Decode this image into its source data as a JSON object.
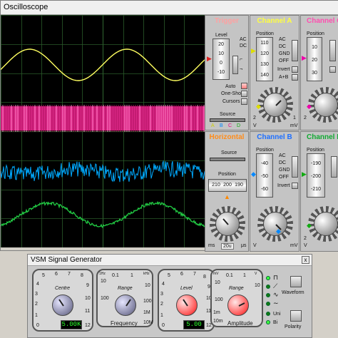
{
  "oscilloscope": {
    "title": "Oscilloscope",
    "colors": {
      "ch_a": "#ffff60",
      "ch_b": "#00aaff",
      "ch_c": "#ff2d9c",
      "ch_d": "#22cc44",
      "grid": "#2a5a2a"
    },
    "trigger": {
      "title": "Trigger",
      "level_label": "Level",
      "level_drum": [
        "20",
        "10",
        "0",
        "-10"
      ],
      "ac_label": "AC",
      "dc_label": "DC",
      "auto_label": "Auto",
      "oneshot_label": "One-Shot",
      "cursors_label": "Cursors",
      "source_label": "Source",
      "source_options": [
        "A",
        "B",
        "C",
        "D"
      ]
    },
    "channel_a": {
      "title": "Channel A",
      "position_label": "Position",
      "drum": [
        "110",
        "120",
        "130",
        "140"
      ],
      "modes": [
        "AC",
        "DC",
        "GND",
        "OFF"
      ],
      "invert_label": "Invert",
      "sum_label": "A+B",
      "knob_left": "2",
      "knob_right": "1",
      "unit_left": "V",
      "unit_right": "mV"
    },
    "channel_c": {
      "title": "Channel C",
      "position_label": "Position",
      "drum": [
        "10",
        "20",
        "30"
      ],
      "knob_left": "2"
    },
    "horizontal": {
      "title": "Horizontal",
      "source_label": "Source",
      "position_label": "Position",
      "drum": [
        "210",
        "200",
        "190"
      ],
      "knob_value": "20u",
      "unit_left": "ms",
      "unit_right": "μs"
    },
    "channel_b": {
      "title": "Channel B",
      "position_label": "Position",
      "drum": [
        "-40",
        "-50",
        "-60"
      ],
      "modes": [
        "AC",
        "DC",
        "GND",
        "OFF"
      ],
      "invert_label": "Invert",
      "unit_left": "V",
      "unit_right": "mV"
    },
    "channel_d": {
      "title": "Channel D",
      "position_label": "Position",
      "drum": [
        "-190",
        "-200",
        "-210"
      ],
      "knob_left": "2",
      "unit_left": "V"
    }
  },
  "generator": {
    "title": "VSM Signal Generator",
    "close_label": "x",
    "frequency": {
      "centre_label": "Centre",
      "centre_scale": [
        "4",
        "5",
        "6",
        "7",
        "8",
        "9",
        "10",
        "11",
        "12",
        "0",
        "1",
        "2",
        "3"
      ],
      "centre_lcd": "5.00K",
      "range_label": "Range",
      "range_scale": [
        "1Hz",
        "10",
        "100",
        "kHz",
        "0.1",
        "1",
        "10",
        "100",
        "1M",
        "10M"
      ],
      "section_label": "Frequency"
    },
    "amplitude": {
      "level_label": "Level",
      "level_scale": [
        "4",
        "5",
        "6",
        "7",
        "8",
        "9",
        "10",
        "11",
        "12",
        "0",
        "1",
        "2",
        "3"
      ],
      "level_lcd": "5.00",
      "range_label": "Range",
      "range_scale": [
        "mV",
        "10",
        "100",
        "V",
        "0.1",
        "1",
        "10",
        "1m",
        "10m"
      ],
      "section_label": "Amplitude"
    },
    "waveform_label": "Waveform",
    "polarity_label": "Polarity",
    "uni_label": "Uni",
    "bi_label": "Bi"
  }
}
